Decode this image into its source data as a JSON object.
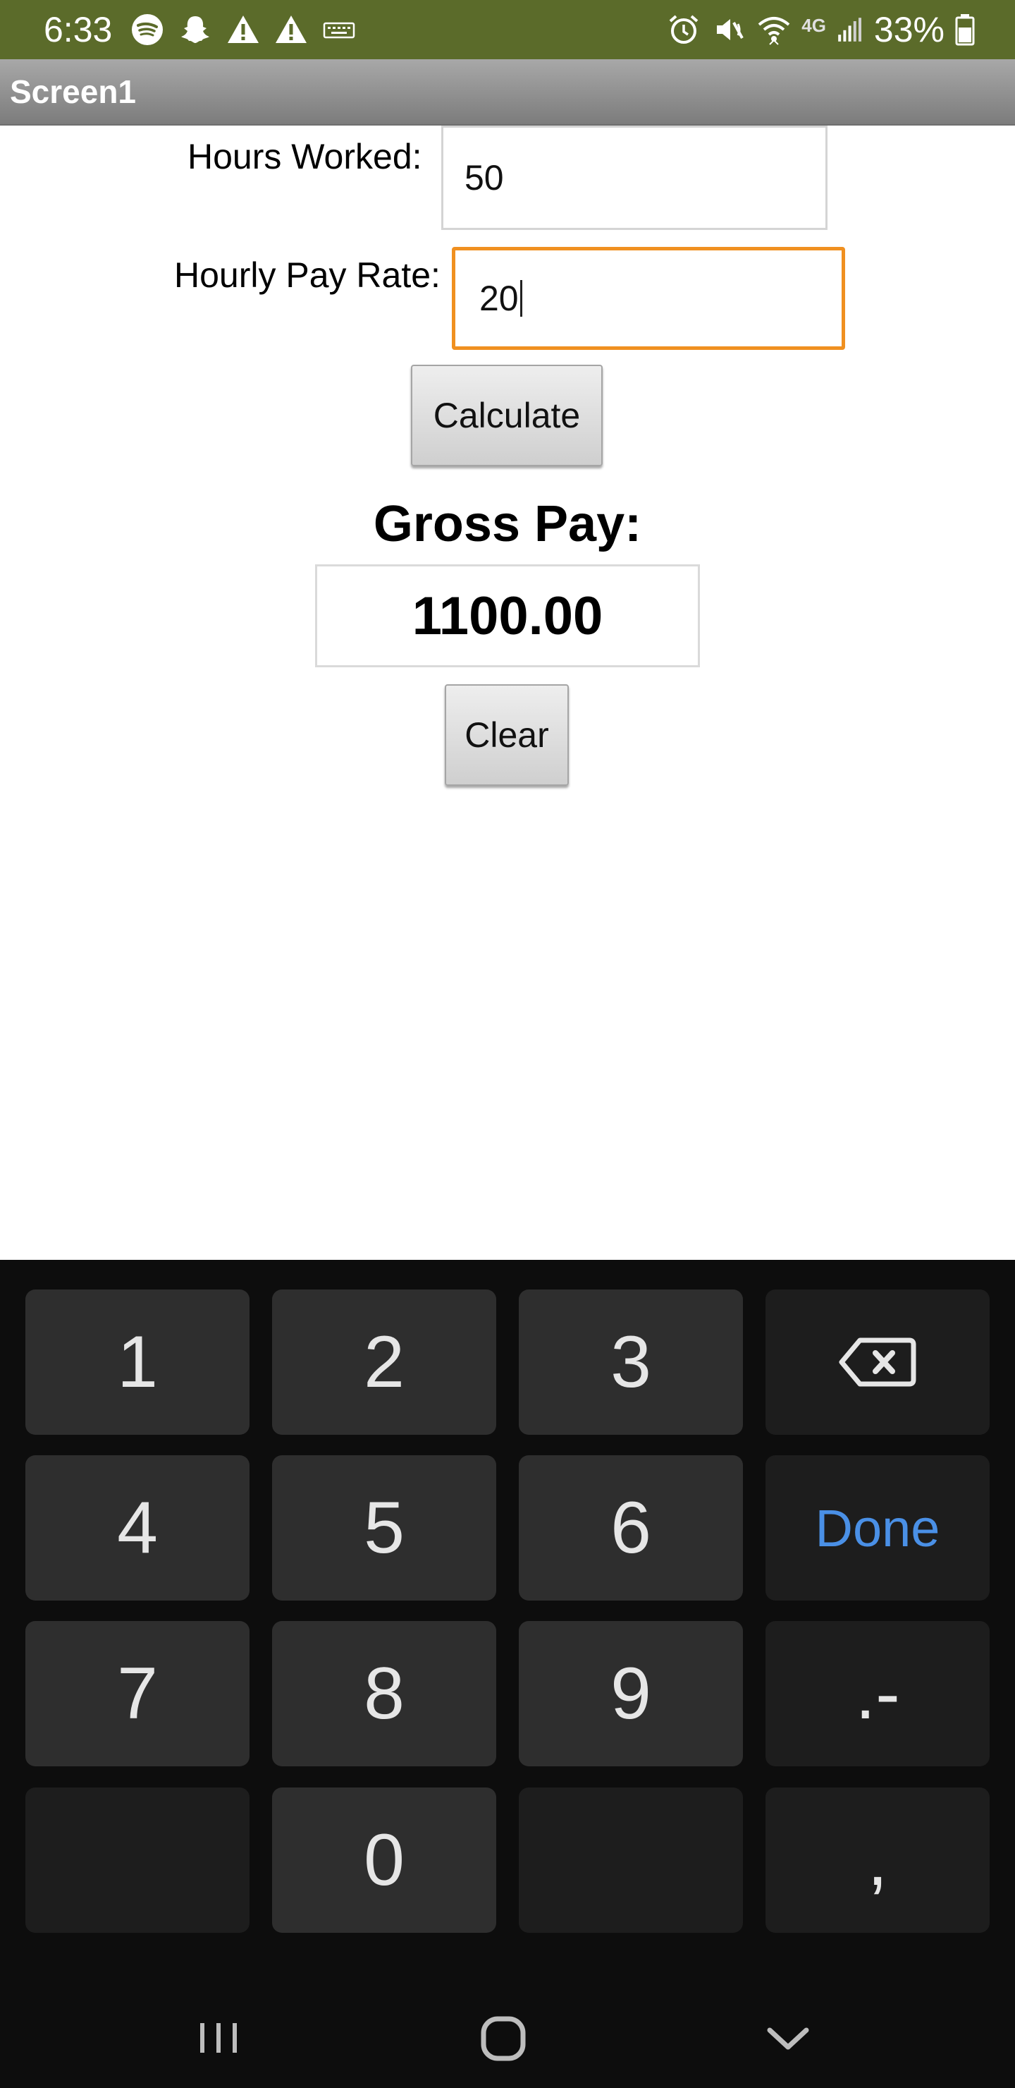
{
  "status_bar": {
    "time": "6:33",
    "battery": "33%",
    "left_icons": [
      "spotify-icon",
      "snapchat-icon",
      "warning-icon",
      "warning-icon",
      "keyboard-icon"
    ],
    "right_icons": [
      "alarm-icon",
      "mute-icon",
      "wifi-icon",
      "4g-lte-icon",
      "signal-icon",
      "battery-icon"
    ],
    "network_label": "4G",
    "background_color": "#5b6b2a"
  },
  "app_bar": {
    "title": "Screen1"
  },
  "form": {
    "hours_label": "Hours Worked:",
    "hours_value": "50",
    "rate_label": "Hourly Pay Rate:",
    "rate_value": "20",
    "calculate_label": "Calculate",
    "gross_label": "Gross Pay:",
    "gross_value": "1100.00",
    "clear_label": "Clear",
    "focus_color": "#f09020"
  },
  "keyboard": {
    "keys": [
      "1",
      "2",
      "3",
      "backspace",
      "4",
      "5",
      "6",
      "Done",
      "7",
      "8",
      "9",
      ".-",
      "",
      "0",
      "",
      ","
    ],
    "done_color": "#4a90e6"
  },
  "nav_bar": {
    "icons": [
      "recent-apps-icon",
      "home-icon",
      "back-icon"
    ]
  }
}
